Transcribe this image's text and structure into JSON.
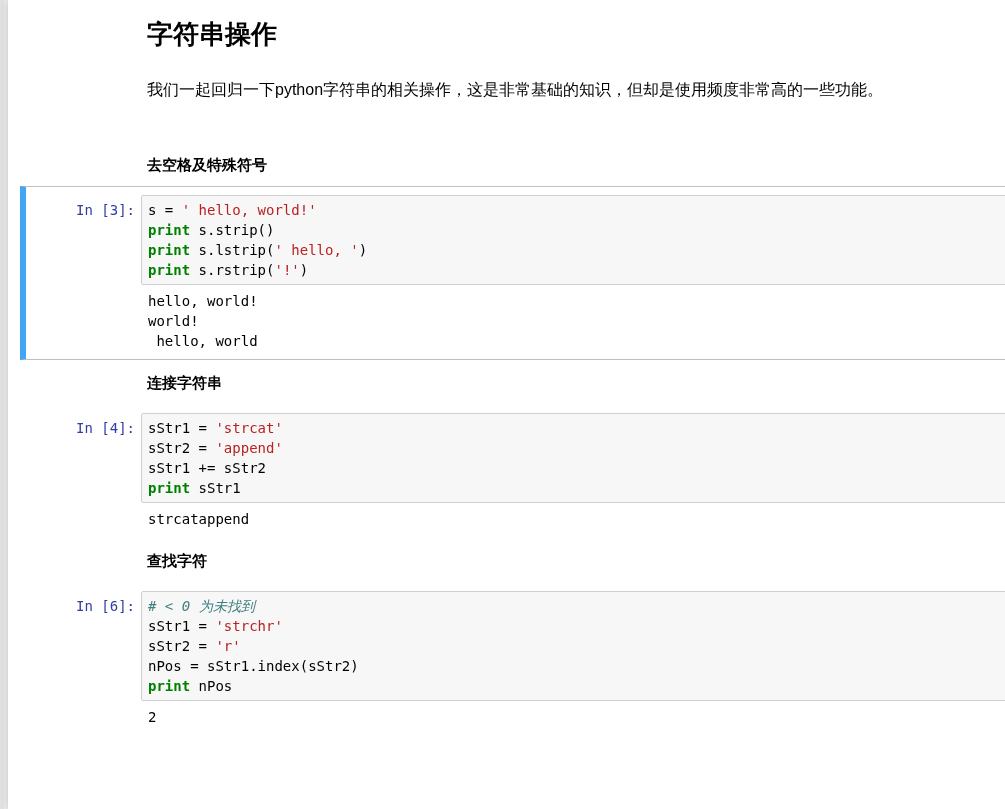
{
  "cells": [
    {
      "kind": "h1",
      "text": "字符串操作"
    },
    {
      "kind": "p",
      "text": "我们一起回归一下python字符串的相关操作，这是非常基础的知识，但却是使用频度非常高的一些功能。"
    },
    {
      "kind": "h4",
      "text": "去空格及特殊符号"
    },
    {
      "kind": "code",
      "selected": true,
      "prompt": "In [3]:",
      "lines": [
        [
          {
            "kind": "plain",
            "text": "s = "
          },
          {
            "kind": "string",
            "text": "' hello, world!'"
          }
        ],
        [
          {
            "kind": "keyword",
            "text": "print"
          },
          {
            "kind": "plain",
            "text": " s.strip()"
          }
        ],
        [
          {
            "kind": "keyword",
            "text": "print"
          },
          {
            "kind": "plain",
            "text": " s.lstrip("
          },
          {
            "kind": "string",
            "text": "' hello, '"
          },
          {
            "kind": "plain",
            "text": ")"
          }
        ],
        [
          {
            "kind": "keyword",
            "text": "print"
          },
          {
            "kind": "plain",
            "text": " s.rstrip("
          },
          {
            "kind": "string",
            "text": "'!'"
          },
          {
            "kind": "plain",
            "text": ")"
          }
        ]
      ],
      "output": "hello, world!\nworld!\n hello, world"
    },
    {
      "kind": "h4",
      "text": "连接字符串"
    },
    {
      "kind": "code",
      "selected": false,
      "prompt": "In [4]:",
      "lines": [
        [
          {
            "kind": "plain",
            "text": "sStr1 = "
          },
          {
            "kind": "string",
            "text": "'strcat'"
          }
        ],
        [
          {
            "kind": "plain",
            "text": "sStr2 = "
          },
          {
            "kind": "string",
            "text": "'append'"
          }
        ],
        [
          {
            "kind": "plain",
            "text": "sStr1 += sStr2"
          }
        ],
        [
          {
            "kind": "keyword",
            "text": "print"
          },
          {
            "kind": "plain",
            "text": " sStr1"
          }
        ]
      ],
      "output": "strcatappend"
    },
    {
      "kind": "h4",
      "text": "查找字符"
    },
    {
      "kind": "code",
      "selected": false,
      "prompt": "In [6]:",
      "lines": [
        [
          {
            "kind": "comment",
            "text": "# < 0 为未找到"
          }
        ],
        [
          {
            "kind": "plain",
            "text": "sStr1 = "
          },
          {
            "kind": "string",
            "text": "'strchr'"
          }
        ],
        [
          {
            "kind": "plain",
            "text": "sStr2 = "
          },
          {
            "kind": "string",
            "text": "'r'"
          }
        ],
        [
          {
            "kind": "plain",
            "text": "nPos = sStr1.index(sStr2)"
          }
        ],
        [
          {
            "kind": "keyword",
            "text": "print"
          },
          {
            "kind": "plain",
            "text": " nPos"
          }
        ]
      ],
      "output": "2"
    }
  ]
}
